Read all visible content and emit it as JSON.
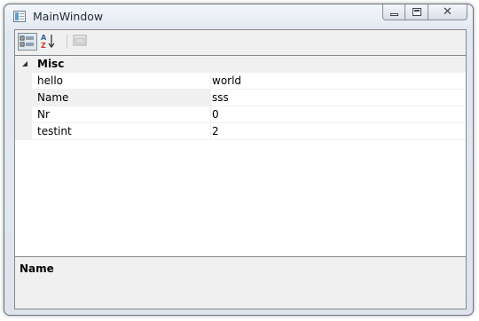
{
  "window": {
    "title": "MainWindow",
    "close_symbol": "✕"
  },
  "toolbar": {
    "buttons": [
      {
        "name": "categorized-icon",
        "selected": true
      },
      {
        "name": "alphabetical-icon",
        "selected": false
      },
      {
        "name": "property-pages-icon",
        "selected": false
      }
    ]
  },
  "grid": {
    "category": "Misc",
    "rows": [
      {
        "name": "hello",
        "value": "world"
      },
      {
        "name": "Name",
        "value": "sss"
      },
      {
        "name": "Nr",
        "value": "0"
      },
      {
        "name": "testint",
        "value": "2"
      }
    ]
  },
  "description": {
    "title": "Name"
  },
  "colors": {
    "category_bg": "#f0f0f0",
    "frame": "#828790",
    "selected_tool": "#dfe7ef"
  }
}
